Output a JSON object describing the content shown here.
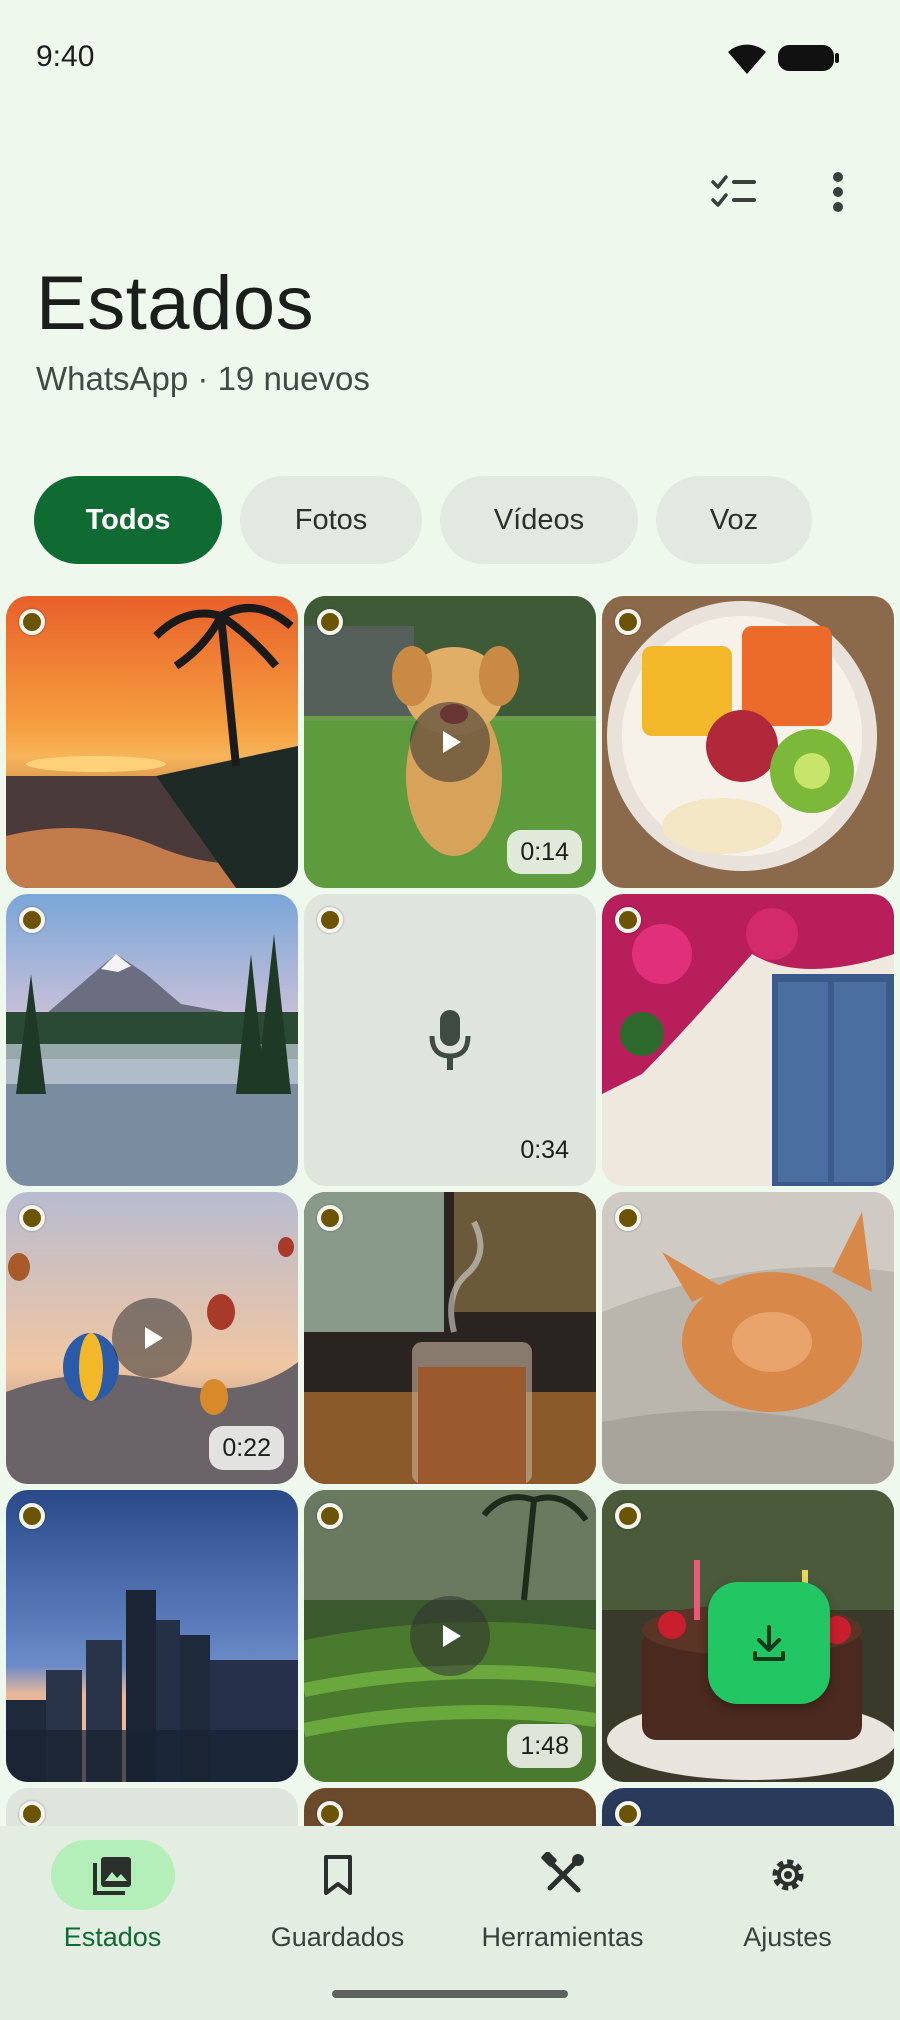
{
  "status_bar": {
    "time": "9:40"
  },
  "header": {
    "title": "Estados",
    "subtitle": "WhatsApp · 19 nuevos",
    "actions": [
      "checklist-icon",
      "more-vert-icon"
    ]
  },
  "filters": [
    "Todos",
    "Fotos",
    "Vídeos",
    "Voz"
  ],
  "active_filter": "Todos",
  "grid": {
    "items": [
      {
        "type": "photo",
        "subject": "beach sunset with palm trees",
        "unseen": true
      },
      {
        "type": "video",
        "subject": "golden retriever puppy running on grass",
        "duration": "0:14",
        "unseen": true
      },
      {
        "type": "photo",
        "subject": "fruit bowl with mango, papaya, kiwi, banana",
        "unseen": true
      },
      {
        "type": "photo",
        "subject": "misty mountain lake with pine trees",
        "unseen": true
      },
      {
        "type": "voice",
        "duration": "0:34",
        "unseen": true
      },
      {
        "type": "photo",
        "subject": "bougainvillea over blue door",
        "unseen": true
      },
      {
        "type": "video",
        "subject": "hot air balloons at sunrise",
        "duration": "0:22",
        "unseen": true
      },
      {
        "type": "photo",
        "subject": "iced coffee by rainy window",
        "unseen": true
      },
      {
        "type": "photo",
        "subject": "sleeping orange kitten on knit blanket",
        "unseen": true
      },
      {
        "type": "photo",
        "subject": "city skyline at dusk",
        "unseen": true
      },
      {
        "type": "video",
        "subject": "rice terraces with palm trees",
        "duration": "1:48",
        "unseen": true
      },
      {
        "type": "photo",
        "subject": "birthday chocolate cake with candles",
        "unseen": true
      },
      {
        "type": "voice",
        "unseen": true
      },
      {
        "type": "photo",
        "subject": "warm indoor lights",
        "unseen": true
      },
      {
        "type": "photo",
        "subject": "night sky",
        "unseen": true
      }
    ]
  },
  "fab": {
    "icon": "download-icon"
  },
  "bottom_nav": [
    {
      "label": "Estados",
      "icon": "photo-library-icon",
      "active": true
    },
    {
      "label": "Guardados",
      "icon": "bookmark-icon",
      "active": false
    },
    {
      "label": "Herramientas",
      "icon": "tools-icon",
      "active": false
    },
    {
      "label": "Ajustes",
      "icon": "gear-icon",
      "active": false
    }
  ],
  "colors": {
    "accent": "#0f6b32",
    "fab": "#22c663",
    "background": "#eef8ec",
    "unseen_dot": "#6b5406"
  }
}
